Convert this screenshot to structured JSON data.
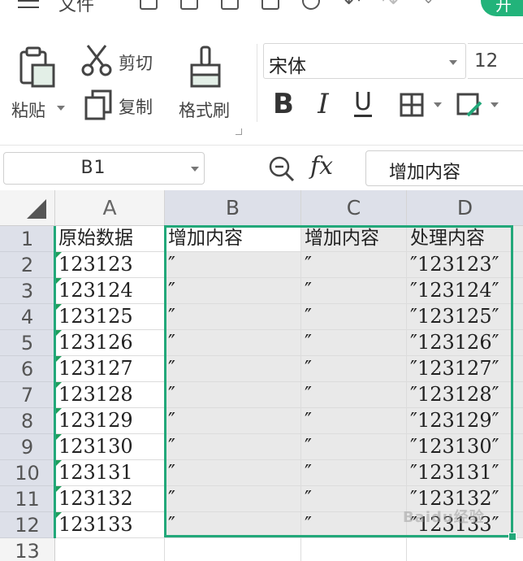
{
  "menu": {
    "file_label": "文件",
    "start_tab_label": "开"
  },
  "ribbon": {
    "paste_label": "粘贴",
    "cut_label": "剪切",
    "copy_label": "复制",
    "format_painter_label": "格式刷",
    "font_name": "宋体",
    "font_size": "12",
    "bold_label": "B",
    "italic_label": "I",
    "underline_label": "U"
  },
  "formula_bar": {
    "cell_ref": "B1",
    "fx_label": "fx",
    "content": "增加内容"
  },
  "sheet": {
    "columns": [
      "A",
      "B",
      "C",
      "D"
    ],
    "row_numbers": [
      "1",
      "2",
      "3",
      "4",
      "5",
      "6",
      "7",
      "8",
      "9",
      "10",
      "11",
      "12",
      "13"
    ],
    "header_row": [
      "原始数据",
      "增加内容",
      "增加内容",
      "处理内容"
    ],
    "rows": [
      [
        "123123",
        "″",
        "″",
        "″123123″"
      ],
      [
        "123124",
        "″",
        "″",
        "″123124″"
      ],
      [
        "123125",
        "″",
        "″",
        "″123125″"
      ],
      [
        "123126",
        "″",
        "″",
        "″123126″"
      ],
      [
        "123127",
        "″",
        "″",
        "″123127″"
      ],
      [
        "123128",
        "″",
        "″",
        "″123128″"
      ],
      [
        "123129",
        "″",
        "″",
        "″123129″"
      ],
      [
        "123130",
        "″",
        "″",
        "″123130″"
      ],
      [
        "123131",
        "″",
        "″",
        "″123131″"
      ],
      [
        "123132",
        "″",
        "″",
        "″123132″"
      ],
      [
        "123133",
        "″",
        "″",
        "″123133″"
      ]
    ]
  },
  "watermark": "Baidu经验",
  "colors": {
    "selection": "#22a87a",
    "selected_header": "#dde0e9",
    "selected_cell": "#e9e9e9",
    "accent_tab": "#22b37a"
  }
}
